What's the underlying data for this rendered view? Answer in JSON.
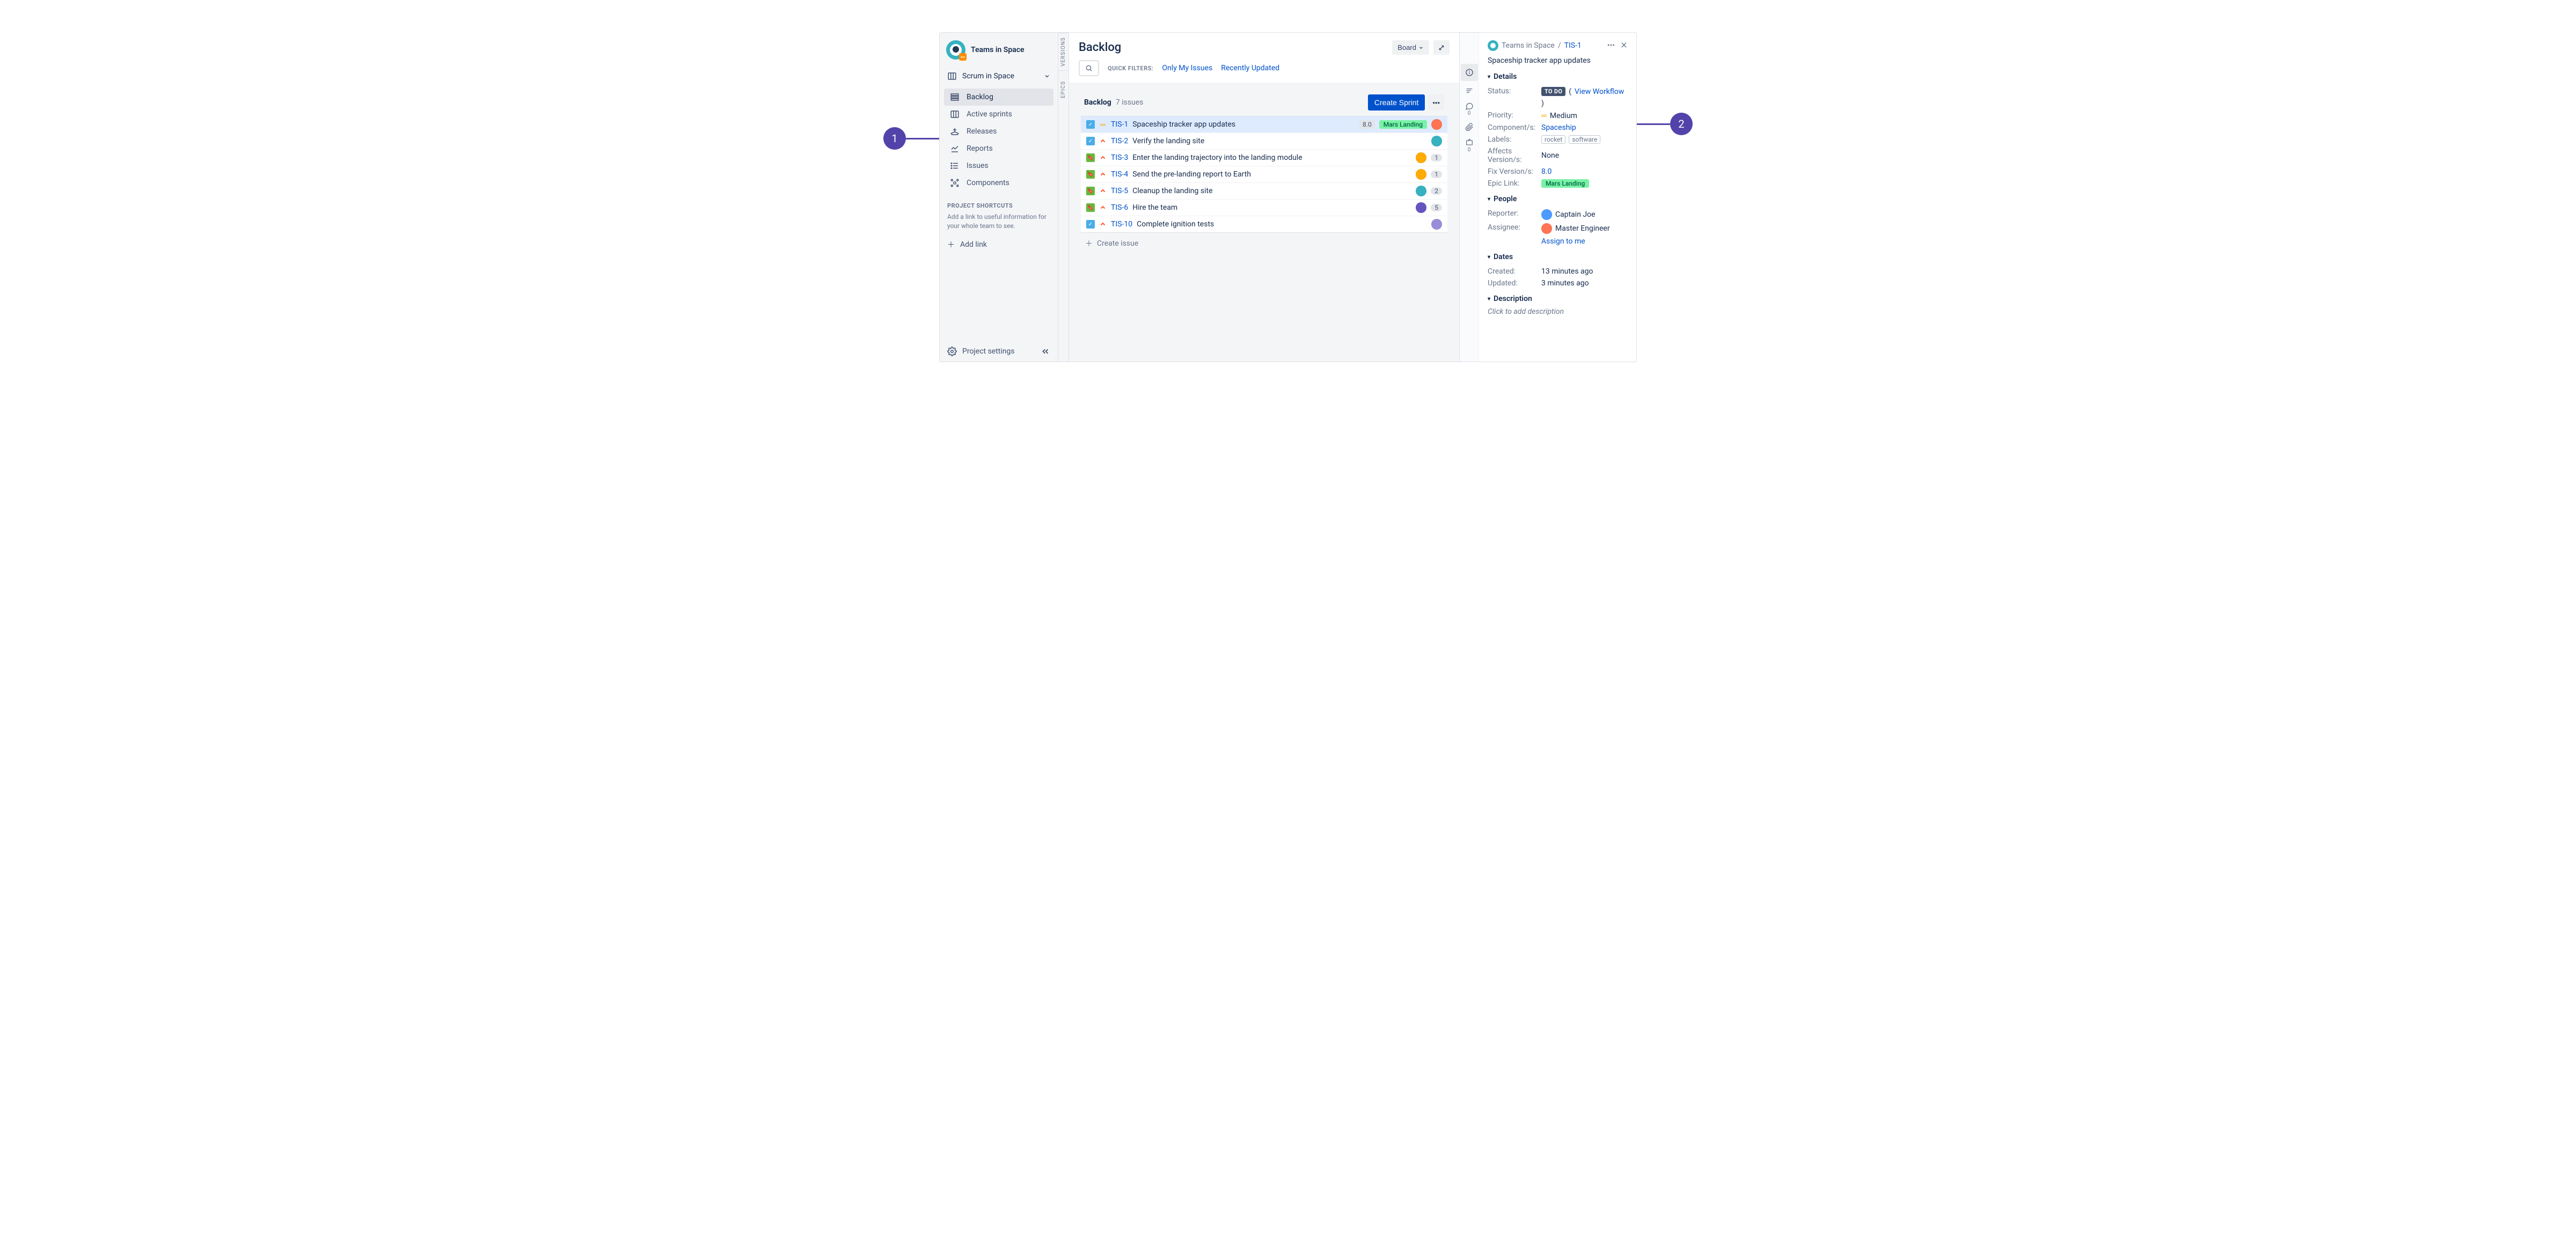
{
  "project": {
    "name": "Teams in Space",
    "board_name": "Scrum in Space"
  },
  "sidebar": {
    "nav": [
      {
        "id": "backlog",
        "label": "Backlog",
        "icon": "backlog",
        "active": true
      },
      {
        "id": "active-sprints",
        "label": "Active sprints",
        "icon": "board",
        "active": false
      },
      {
        "id": "releases",
        "label": "Releases",
        "icon": "ship",
        "active": false
      },
      {
        "id": "reports",
        "label": "Reports",
        "icon": "chart",
        "active": false
      },
      {
        "id": "issues",
        "label": "Issues",
        "icon": "list",
        "active": false
      },
      {
        "id": "components",
        "label": "Components",
        "icon": "component",
        "active": false
      }
    ],
    "shortcuts_heading": "PROJECT SHORTCUTS",
    "shortcuts_help": "Add a link to useful information for your whole team to see.",
    "add_link": "Add link",
    "settings": "Project settings"
  },
  "vtabs": {
    "versions": "VERSIONS",
    "epics": "EPICS"
  },
  "header": {
    "title": "Backlog",
    "board_button": "Board",
    "quick_filters_label": "QUICK FILTERS:",
    "filters": [
      "Only My Issues",
      "Recently Updated"
    ]
  },
  "backlog": {
    "title": "Backlog",
    "count_label": "7 issues",
    "create_sprint": "Create Sprint",
    "create_issue": "Create issue",
    "issues": [
      {
        "type": "task",
        "priority": "medium",
        "key": "TIS-1",
        "summary": "Spaceship tracker app updates",
        "version": "8.0",
        "epic": "Mars Landing",
        "avatar": "d",
        "count": null,
        "selected": true
      },
      {
        "type": "task",
        "priority": "high",
        "key": "TIS-2",
        "summary": "Verify the landing site",
        "version": null,
        "epic": null,
        "avatar": "b",
        "count": null,
        "selected": false
      },
      {
        "type": "story",
        "priority": "high",
        "key": "TIS-3",
        "summary": "Enter the landing trajectory into the landing module",
        "version": null,
        "epic": null,
        "avatar": "a",
        "count": "1",
        "selected": false
      },
      {
        "type": "story",
        "priority": "high",
        "key": "TIS-4",
        "summary": "Send the pre-landing report to Earth",
        "version": null,
        "epic": null,
        "avatar": "a",
        "count": "1",
        "selected": false
      },
      {
        "type": "story",
        "priority": "high",
        "key": "TIS-5",
        "summary": "Cleanup the landing site",
        "version": null,
        "epic": null,
        "avatar": "b",
        "count": "2",
        "selected": false
      },
      {
        "type": "story",
        "priority": "high",
        "key": "TIS-6",
        "summary": "Hire the team",
        "version": null,
        "epic": null,
        "avatar": "c",
        "count": "5",
        "selected": false
      },
      {
        "type": "task",
        "priority": "high",
        "key": "TIS-10",
        "summary": "Complete ignition tests",
        "version": null,
        "epic": null,
        "avatar": "e",
        "count": null,
        "selected": false
      }
    ]
  },
  "detail": {
    "project_name": "Teams in Space",
    "key": "TIS-1",
    "summary": "Spaceship tracker app updates",
    "sections": {
      "details": "Details",
      "people": "People",
      "dates": "Dates",
      "description": "Description"
    },
    "status": {
      "label": "Status:",
      "value": "TO DO",
      "workflow_link": "View Workflow"
    },
    "priority": {
      "label": "Priority:",
      "value": "Medium"
    },
    "components": {
      "label": "Component/s:",
      "value": "Spaceship"
    },
    "labels": {
      "label": "Labels:",
      "values": [
        "rocket",
        "software"
      ]
    },
    "affects": {
      "label": "Affects Version/s:",
      "value": "None"
    },
    "fixversion": {
      "label": "Fix Version/s:",
      "value": "8.0"
    },
    "epic": {
      "label": "Epic Link:",
      "value": "Mars Landing"
    },
    "reporter": {
      "label": "Reporter:",
      "value": "Captain Joe"
    },
    "assignee": {
      "label": "Assignee:",
      "value": "Master Engineer"
    },
    "assign_me": "Assign to me",
    "created": {
      "label": "Created:",
      "value": "13 minutes ago"
    },
    "updated": {
      "label": "Updated:",
      "value": "3 minutes ago"
    },
    "desc_placeholder": "Click to add description",
    "icon_counts": {
      "comments": "0",
      "releases": "0"
    }
  },
  "annotations": {
    "one": "1",
    "two": "2"
  }
}
